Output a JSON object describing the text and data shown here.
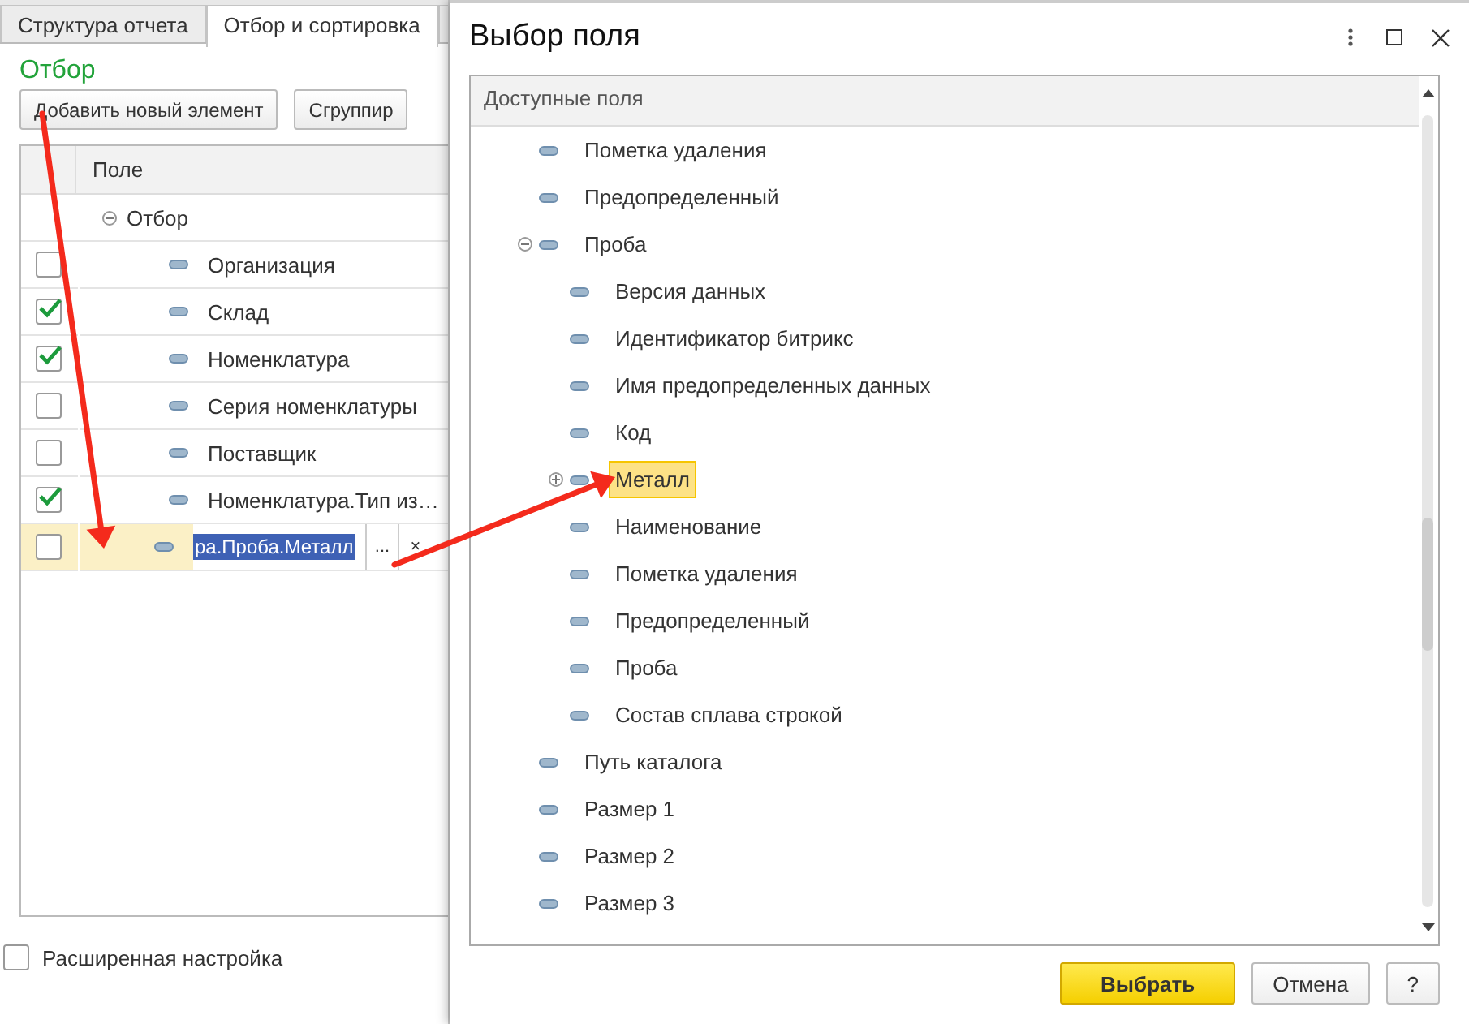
{
  "left_panel": {
    "tabs": [
      {
        "label": "Структура отчета",
        "selected": false
      },
      {
        "label": "Отбор и сортировка",
        "selected": true
      },
      {
        "selected": false
      }
    ],
    "section_title": "Отбор",
    "buttons": [
      "Добавить новый элемент",
      "Сгруппир"
    ],
    "table": {
      "columns": [
        "Поле"
      ],
      "group": {
        "label": "Отбор",
        "expanded": true
      },
      "rows": [
        {
          "label": "Организация",
          "checked": false,
          "selected": false
        },
        {
          "label": "Склад",
          "checked": true,
          "selected": false
        },
        {
          "label": "Номенклатура",
          "checked": true,
          "selected": false
        },
        {
          "label": "Серия номенклатуры",
          "checked": false,
          "selected": false
        },
        {
          "label": "Поставщик",
          "checked": false,
          "selected": false
        },
        {
          "label": "Номенклатура.Тип из…",
          "checked": true,
          "selected": false
        },
        {
          "label": "ра.Проба.Металл",
          "checked": false,
          "selected": true,
          "kind": "editing",
          "text_selected": true,
          "choice_button": "...",
          "clear_button": "×"
        }
      ]
    },
    "advanced": {
      "label": "Расширенная настройка",
      "checked": false
    }
  },
  "dialog": {
    "title": "Выбор поля",
    "tree": {
      "header": "Доступные поля",
      "items": [
        {
          "label": "Пометка удаления",
          "selected": false
        },
        {
          "label": "Предопределенный",
          "selected": false
        },
        {
          "label": "Проба",
          "selected": false,
          "expanded": true,
          "children": [
            {
              "label": "Версия данных",
              "selected": false
            },
            {
              "label": "Идентификатор битрикс",
              "selected": false
            },
            {
              "label": "Имя предопределенных данных",
              "selected": false
            },
            {
              "label": "Код",
              "selected": false
            },
            {
              "label": "Металл",
              "selected": true,
              "expanded": false
            },
            {
              "label": "Наименование",
              "selected": false
            },
            {
              "label": "Пометка удаления",
              "selected": false
            },
            {
              "label": "Предопределенный",
              "selected": false
            },
            {
              "label": "Проба",
              "selected": false
            },
            {
              "label": "Состав сплава строкой",
              "selected": false
            }
          ]
        },
        {
          "label": "Путь каталога",
          "selected": false
        },
        {
          "label": "Размер 1",
          "selected": false
        },
        {
          "label": "Размер 2",
          "selected": false
        },
        {
          "label": "Размер 3",
          "selected": false
        }
      ]
    },
    "buttons": [
      {
        "label": "Выбрать",
        "kind": "primary"
      },
      {
        "label": "Отмена",
        "kind": "normal"
      },
      {
        "label": "?",
        "kind": "normal"
      }
    ]
  },
  "annotations": [
    {
      "kind": "arrow"
    },
    {
      "kind": "arrow"
    }
  ]
}
